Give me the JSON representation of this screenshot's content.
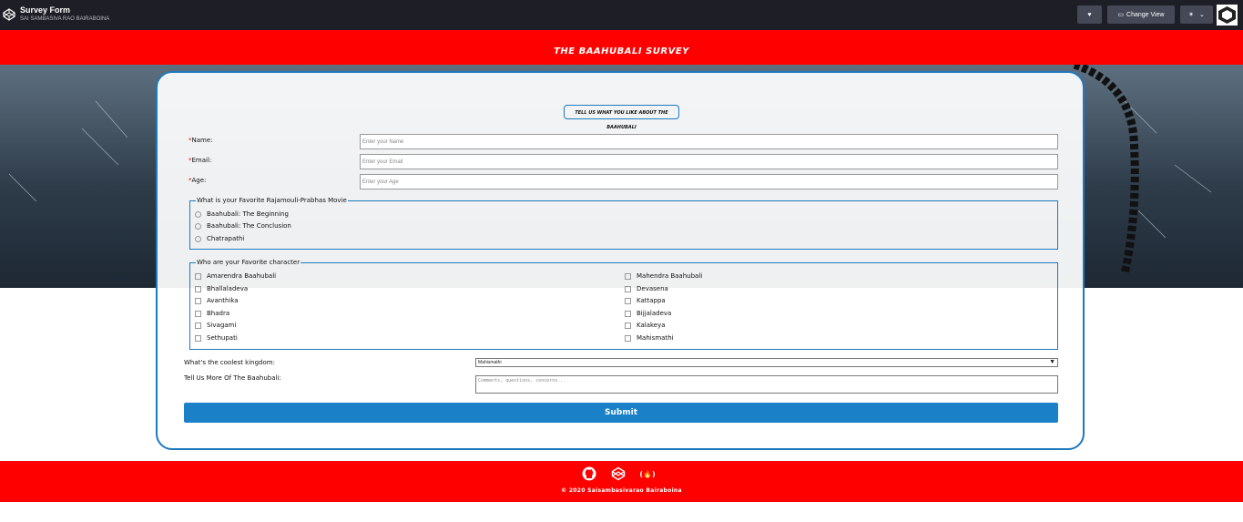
{
  "topbar": {
    "title": "Survey Form",
    "author": "SAI SAMBASIVA RAO BAIRABOINA",
    "change_view": "Change View"
  },
  "header": {
    "title": "THE BAAHUBALI SURVEY"
  },
  "form": {
    "subtitle": "TELL US WHAT YOU LIKE ABOUT THE BAAHUBALI",
    "required_mark": "*",
    "name_label": "Name:",
    "name_placeholder": "Enter your Name",
    "email_label": "Email:",
    "email_placeholder": "Enter your Email",
    "age_label": "Age:",
    "age_placeholder": "Enter your Age",
    "movie_legend": "What is your Favorite Rajamouli-Prabhas Movie",
    "movies": [
      "Baahubali: The Beginning",
      "Baahubali: The Conclusion",
      "Chatrapathi"
    ],
    "character_legend": "Who are your Favorite character",
    "characters_left": [
      "Amarendra Baahubali",
      "Bhallaladeva",
      "Avanthika",
      "Bhadra",
      "Sivagami",
      "Sethupati"
    ],
    "characters_right": [
      "Mahendra Baahubali",
      "Devasena",
      "Kattappa",
      "Bijjaladeva",
      "Kalakeya",
      "Mahismathi"
    ],
    "kingdom_label": "What's the coolest kingdom:",
    "kingdom_selected": "Mahismathi",
    "more_label": "Tell Us More Of The Baahubali:",
    "more_placeholder": "Comments, questions, concerns...",
    "submit_label": "Submit"
  },
  "footer": {
    "copyright": "© 2020 Saisambasivarao Bairaboina",
    "codepen_icon_text": "",
    "fcc_icon_text": "(🔥)"
  },
  "colors": {
    "brand_red": "#ff0000",
    "accent_blue": "#1f79bd",
    "button_blue": "#1a80c8"
  }
}
